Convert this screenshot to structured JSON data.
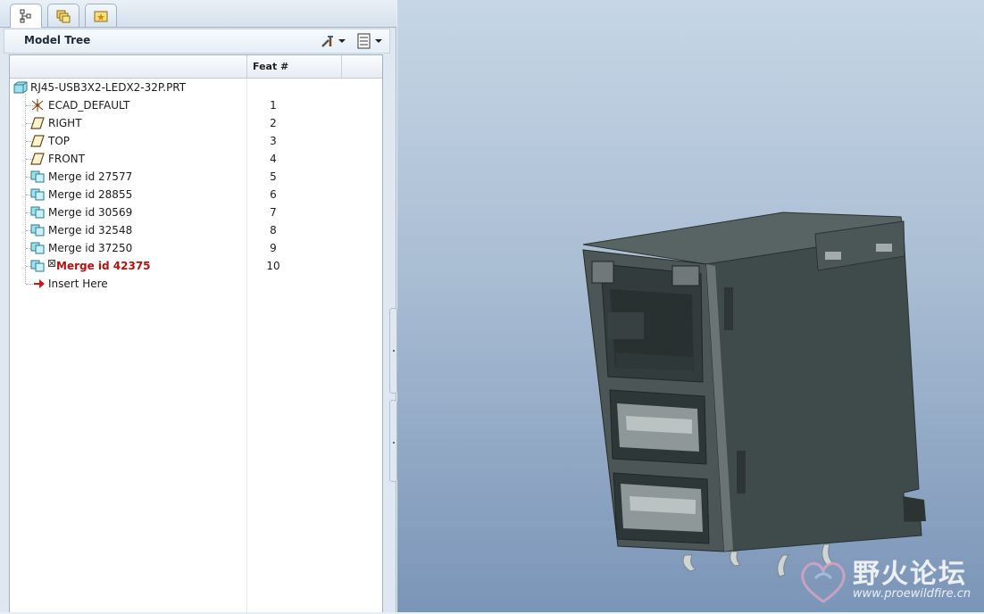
{
  "nav_tabs": [
    {
      "name": "model-tree-tab",
      "icon": "tree-hierarchy-icon",
      "active": true
    },
    {
      "name": "folder-browser-tab",
      "icon": "layers-folders-icon",
      "active": false
    },
    {
      "name": "favorites-tab",
      "icon": "star-folder-icon",
      "active": false
    }
  ],
  "toolbar": {
    "title": "Model Tree",
    "settings_icon": "tools-settings-icon",
    "show_icon": "show-list-icon"
  },
  "tree": {
    "column_feat": "Feat #",
    "root": {
      "label": "RJ45-USB3X2-LEDX2-32P.PRT",
      "icon": "part-icon"
    },
    "items": [
      {
        "label": "ECAD_DEFAULT",
        "feat": "1",
        "icon": "coordinate-system-icon"
      },
      {
        "label": "RIGHT",
        "feat": "2",
        "icon": "datum-plane-icon"
      },
      {
        "label": "TOP",
        "feat": "3",
        "icon": "datum-plane-icon"
      },
      {
        "label": "FRONT",
        "feat": "4",
        "icon": "datum-plane-icon"
      },
      {
        "label": "Merge id 27577",
        "feat": "5",
        "icon": "merge-feature-icon"
      },
      {
        "label": "Merge id 28855",
        "feat": "6",
        "icon": "merge-feature-icon"
      },
      {
        "label": "Merge id 30569",
        "feat": "7",
        "icon": "merge-feature-icon"
      },
      {
        "label": "Merge id 32548",
        "feat": "8",
        "icon": "merge-feature-icon"
      },
      {
        "label": "Merge id 37250",
        "feat": "9",
        "icon": "merge-feature-icon"
      },
      {
        "label": "Merge id 42375",
        "feat": "10",
        "icon": "merge-feature-icon",
        "highlight": true
      },
      {
        "label": "Insert Here",
        "feat": "",
        "icon": "insert-arrow-icon"
      }
    ]
  },
  "watermark": {
    "text": "野火论坛",
    "url": "www.proewildfire.cn"
  },
  "colors": {
    "highlight_red": "#b5120f",
    "model_body": "#3f4a4a",
    "viewport_top": "#c6d6e6",
    "viewport_bottom": "#7b95b8"
  }
}
